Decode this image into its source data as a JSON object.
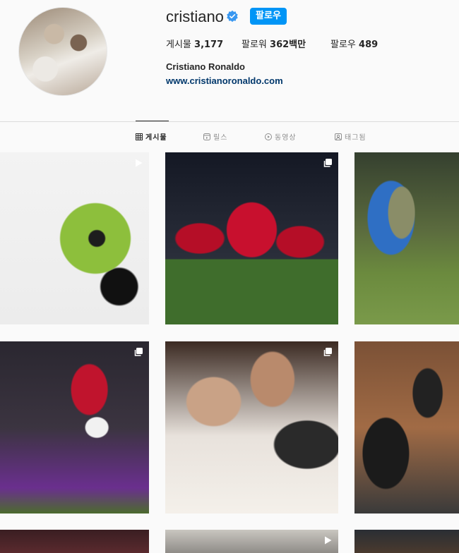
{
  "profile": {
    "username": "cristiano",
    "verified": true,
    "follow_label": "팔로우",
    "full_name": "Cristiano Ronaldo",
    "website": "www.cristianoronaldo.com",
    "stats": {
      "posts_label": "게시물",
      "posts_value": "3,177",
      "followers_label": "팔로워",
      "followers_value": "362백만",
      "following_label": "팔로우",
      "following_value": "489"
    }
  },
  "tabs": [
    {
      "label": "게시물",
      "icon": "grid-icon",
      "active": true
    },
    {
      "label": "릴스",
      "icon": "reels-icon",
      "active": false
    },
    {
      "label": "동영상",
      "icon": "video-icon",
      "active": false
    },
    {
      "label": "태그됨",
      "icon": "tagged-icon",
      "active": false
    }
  ],
  "colors": {
    "accent": "#0095f6",
    "link": "#00376b",
    "text": "#262626",
    "muted": "#8e8e8e",
    "background": "#fafafa"
  },
  "posts": [
    {
      "badge": "reel-icon"
    },
    {
      "badge": "carousel-icon"
    },
    {
      "badge": null
    },
    {
      "badge": "carousel-icon"
    },
    {
      "badge": "carousel-icon"
    },
    {
      "badge": null
    },
    {
      "badge": null
    },
    {
      "badge": "reel-icon"
    },
    {
      "badge": null
    }
  ]
}
